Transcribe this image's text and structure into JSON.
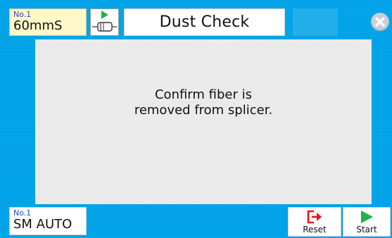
{
  "header": {
    "program_no": "No.1",
    "program_value": "60mmS",
    "title": "Dust Check"
  },
  "message": {
    "line1": "Confirm fiber is",
    "line2": "removed from splicer."
  },
  "footer": {
    "mode_no": "No.1",
    "mode_value": "SM AUTO",
    "reset_label": "Reset",
    "start_label": "Start"
  },
  "icons": {
    "splice": "fiber-splice-icon",
    "close": "close-icon",
    "reset": "reset-exit-icon",
    "start": "play-icon"
  },
  "colors": {
    "background": "#00a2e8",
    "program_box": "#fff8c8",
    "accent_green": "#22b14c",
    "reset_red": "#e8141c",
    "label_blue": "#1b47c9"
  }
}
